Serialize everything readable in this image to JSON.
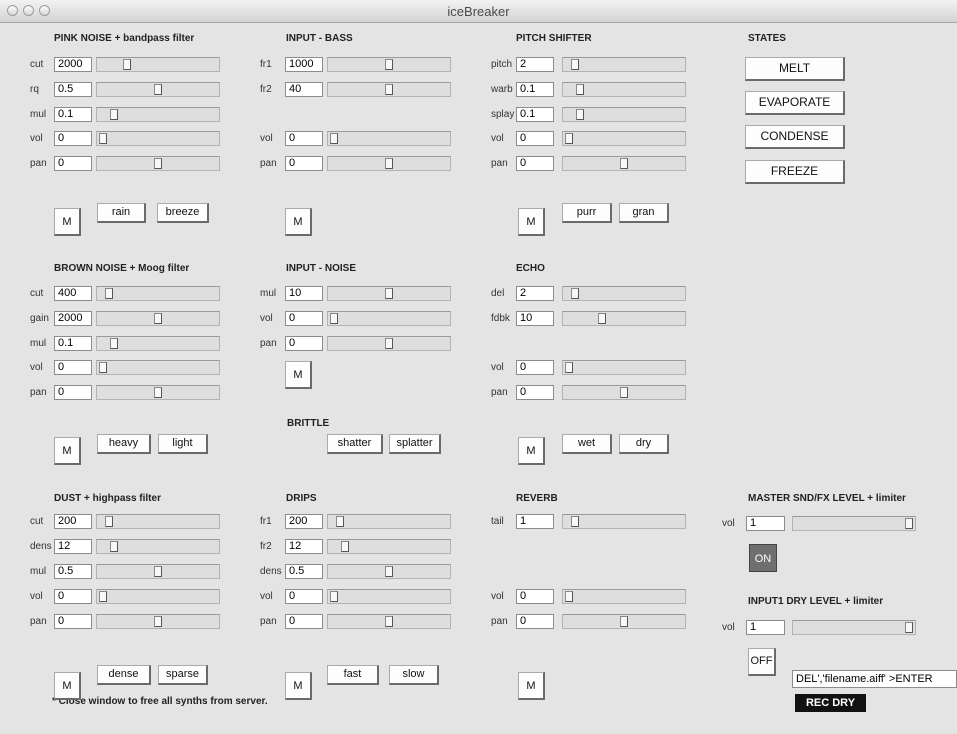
{
  "window": {
    "title": "iceBreaker"
  },
  "pink": {
    "title": "PINK NOISE + bandpass filter",
    "rows": [
      {
        "label": "cut",
        "value": "2000",
        "level": 0.22
      },
      {
        "label": "rq",
        "value": "0.5",
        "level": 0.5
      },
      {
        "label": "mul",
        "value": "0.1",
        "level": 0.1
      },
      {
        "label": "vol",
        "value": "0",
        "level": 0.0
      },
      {
        "label": "pan",
        "value": "0",
        "level": 0.5
      }
    ],
    "mute": "M",
    "btn1": "rain",
    "btn2": "breeze"
  },
  "bass": {
    "title": "INPUT - BASS",
    "rows": [
      {
        "label": "fr1",
        "value": "1000",
        "level": 0.5
      },
      {
        "label": "fr2",
        "value": "40",
        "level": 0.5
      },
      {
        "label": "vol",
        "value": "0",
        "level": 0.0
      },
      {
        "label": "pan",
        "value": "0",
        "level": 0.5
      }
    ],
    "mute": "M"
  },
  "pitch": {
    "title": "PITCH SHIFTER",
    "rows": [
      {
        "label": "pitch",
        "value": "2",
        "level": 0.05
      },
      {
        "label": "warb",
        "value": "0.1",
        "level": 0.1
      },
      {
        "label": "splay",
        "value": "0.1",
        "level": 0.1
      },
      {
        "label": "vol",
        "value": "0",
        "level": 0.0
      },
      {
        "label": "pan",
        "value": "0",
        "level": 0.5
      }
    ],
    "mute": "M",
    "btn1": "purr",
    "btn2": "gran"
  },
  "states": {
    "title": "STATES",
    "buttons": [
      "MELT",
      "EVAPORATE",
      "CONDENSE",
      "FREEZE"
    ]
  },
  "brown": {
    "title": "BROWN NOISE + Moog filter",
    "rows": [
      {
        "label": "cut",
        "value": "400",
        "level": 0.05
      },
      {
        "label": "gain",
        "value": "2000",
        "level": 0.5
      },
      {
        "label": "mul",
        "value": "0.1",
        "level": 0.1
      },
      {
        "label": "vol",
        "value": "0",
        "level": 0.0
      },
      {
        "label": "pan",
        "value": "0",
        "level": 0.5
      }
    ],
    "mute": "M",
    "btn1": "heavy",
    "btn2": "light"
  },
  "inoise": {
    "title": "INPUT - NOISE",
    "rows": [
      {
        "label": "mul",
        "value": "10",
        "level": 0.5
      },
      {
        "label": "vol",
        "value": "0",
        "level": 0.0
      },
      {
        "label": "pan",
        "value": "0",
        "level": 0.5
      }
    ],
    "mute": "M"
  },
  "brittle": {
    "title": "BRITTLE",
    "btn1": "shatter",
    "btn2": "splatter"
  },
  "echo": {
    "title": "ECHO",
    "rows": [
      {
        "label": "del",
        "value": "2",
        "level": 0.05
      },
      {
        "label": "fdbk",
        "value": "10",
        "level": 0.3
      },
      {
        "label": "vol",
        "value": "0",
        "level": 0.0
      },
      {
        "label": "pan",
        "value": "0",
        "level": 0.5
      }
    ],
    "mute": "M",
    "btn1": "wet",
    "btn2": "dry"
  },
  "dust": {
    "title": "DUST + highpass filter",
    "rows": [
      {
        "label": "cut",
        "value": "200",
        "level": 0.05
      },
      {
        "label": "dens",
        "value": "12",
        "level": 0.1
      },
      {
        "label": "mul",
        "value": "0.5",
        "level": 0.5
      },
      {
        "label": "vol",
        "value": "0",
        "level": 0.0
      },
      {
        "label": "pan",
        "value": "0",
        "level": 0.5
      }
    ],
    "mute": "M",
    "btn1": "dense",
    "btn2": "sparse"
  },
  "drips": {
    "title": "DRIPS",
    "rows": [
      {
        "label": "fr1",
        "value": "200",
        "level": 0.05
      },
      {
        "label": "fr2",
        "value": "12",
        "level": 0.1
      },
      {
        "label": "dens",
        "value": "0.5",
        "level": 0.5
      },
      {
        "label": "vol",
        "value": "0",
        "level": 0.0
      },
      {
        "label": "pan",
        "value": "0",
        "level": 0.5
      }
    ],
    "mute": "M",
    "btn1": "fast",
    "btn2": "slow"
  },
  "reverb": {
    "title": "REVERB",
    "rows": [
      {
        "label": "tail",
        "value": "1",
        "level": 0.05
      },
      {
        "label": "vol",
        "value": "0",
        "level": 0.0
      },
      {
        "label": "pan",
        "value": "0",
        "level": 0.5
      }
    ],
    "mute": "M"
  },
  "master": {
    "title": "MASTER SND/FX LEVEL + limiter",
    "vol_label": "vol",
    "vol_value": "1",
    "level": 1.0,
    "on_label": "ON"
  },
  "dry": {
    "title": "INPUT1 DRY LEVEL + limiter",
    "vol_label": "vol",
    "vol_value": "1",
    "level": 1.0,
    "off_label": "OFF",
    "command": "DEL','filename.aiff' >ENTER",
    "rec_label": "REC DRY"
  },
  "footer": "* Close window to free all synths from server."
}
